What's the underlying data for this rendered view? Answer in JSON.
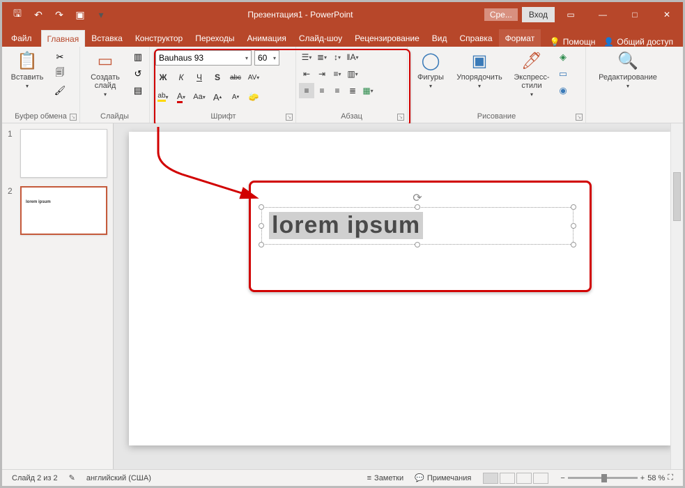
{
  "titlebar": {
    "title": "Презентация1 - PowerPoint",
    "tools_badge": "Сре...",
    "login": "Вход"
  },
  "tabs": {
    "file": "Файл",
    "home": "Главная",
    "insert": "Вставка",
    "design": "Конструктор",
    "transitions": "Переходы",
    "animation": "Анимация",
    "slideshow": "Слайд-шоу",
    "review": "Рецензирование",
    "view": "Вид",
    "help": "Справка",
    "format": "Формат",
    "assist": "Помощн",
    "share": "Общий доступ"
  },
  "ribbon": {
    "clipboard": {
      "paste": "Вставить",
      "group_label": "Буфер обмена"
    },
    "slides": {
      "new_slide": "Создать\nслайд",
      "group_label": "Слайды"
    },
    "font": {
      "font_name": "Bauhaus 93",
      "font_size": "60",
      "bold": "Ж",
      "italic": "К",
      "underline": "Ч",
      "shadow": "S",
      "strikethrough": "abc",
      "char_spacing": "AV",
      "highlight": "ab",
      "font_color": "A",
      "change_case": "Aa",
      "grow_font": "A",
      "shrink_font": "A",
      "clear": "◔",
      "group_label": "Шрифт"
    },
    "paragraph": {
      "group_label": "Абзац"
    },
    "drawing": {
      "shapes": "Фигуры",
      "arrange": "Упорядочить",
      "quick_styles": "Экспресс-\nстили",
      "group_label": "Рисование"
    },
    "editing": {
      "label": "Редактирование"
    }
  },
  "thumbnails": {
    "slide1_num": "1",
    "slide2_num": "2",
    "slide2_preview_text": "lorem ipsum"
  },
  "canvas": {
    "textbox_text": "lorem ipsum"
  },
  "status": {
    "slide_counter": "Слайд 2 из 2",
    "language": "английский (США)",
    "notes": "Заметки",
    "comments": "Примечания",
    "zoom_percent": "58 %"
  }
}
